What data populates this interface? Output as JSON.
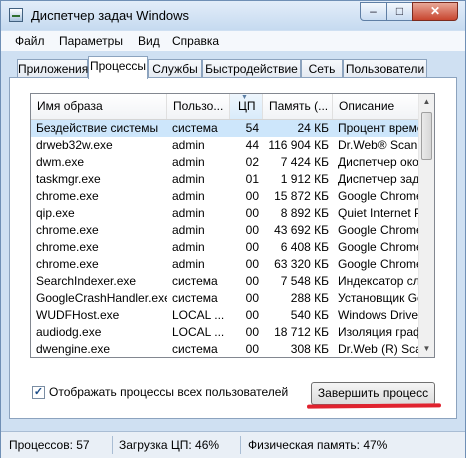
{
  "window": {
    "title": "Диспетчер задач Windows",
    "close_glyph": "✕",
    "min_glyph": "–",
    "max_glyph": "□"
  },
  "menu": [
    "Файл",
    "Параметры",
    "Вид",
    "Справка"
  ],
  "tabs": [
    "Приложения",
    "Процессы",
    "Службы",
    "Быстродействие",
    "Сеть",
    "Пользователи"
  ],
  "active_tab": "Процессы",
  "columns": [
    "Имя образа",
    "Пользо...",
    "ЦП",
    "Память (...",
    "Описание"
  ],
  "processes": [
    {
      "name": "Бездействие системы",
      "user": "система",
      "cpu": "54",
      "mem": "24 КБ",
      "desc": "Процент времен"
    },
    {
      "name": "drweb32w.exe",
      "user": "admin",
      "cpu": "44",
      "mem": "116 904 КБ",
      "desc": "Dr.Web® Scann"
    },
    {
      "name": "dwm.exe",
      "user": "admin",
      "cpu": "02",
      "mem": "7 424 КБ",
      "desc": "Диспетчер окон"
    },
    {
      "name": "taskmgr.exe",
      "user": "admin",
      "cpu": "01",
      "mem": "1 912 КБ",
      "desc": "Диспетчер зада"
    },
    {
      "name": "chrome.exe",
      "user": "admin",
      "cpu": "00",
      "mem": "15 872 КБ",
      "desc": "Google Chrome"
    },
    {
      "name": "qip.exe",
      "user": "admin",
      "cpu": "00",
      "mem": "8 892 КБ",
      "desc": "Quiet Internet P"
    },
    {
      "name": "chrome.exe",
      "user": "admin",
      "cpu": "00",
      "mem": "43 692 КБ",
      "desc": "Google Chrome"
    },
    {
      "name": "chrome.exe",
      "user": "admin",
      "cpu": "00",
      "mem": "6 408 КБ",
      "desc": "Google Chrome"
    },
    {
      "name": "chrome.exe",
      "user": "admin",
      "cpu": "00",
      "mem": "63 320 КБ",
      "desc": "Google Chrome"
    },
    {
      "name": "SearchIndexer.exe",
      "user": "система",
      "cpu": "00",
      "mem": "7 548 КБ",
      "desc": "Индексатор слу"
    },
    {
      "name": "GoogleCrashHandler.exe",
      "user": "система",
      "cpu": "00",
      "mem": "288 КБ",
      "desc": "Установщик Goo"
    },
    {
      "name": "WUDFHost.exe",
      "user": "LOCAL ...",
      "cpu": "00",
      "mem": "540 КБ",
      "desc": "Windows Driver"
    },
    {
      "name": "audiodg.exe",
      "user": "LOCAL ...",
      "cpu": "00",
      "mem": "18 712 КБ",
      "desc": "Изоляция графо"
    },
    {
      "name": "dwengine.exe",
      "user": "система",
      "cpu": "00",
      "mem": "308 КБ",
      "desc": "Dr.Web (R) Scar"
    }
  ],
  "show_all_users_label": "Отображать процессы всех пользователей",
  "show_all_users_checked": true,
  "end_process_label": "Завершить процесс",
  "status": {
    "processes": "Процессов: 57",
    "cpu": "Загрузка ЦП: 46%",
    "memory": "Физическая память: 47%"
  },
  "colors": {
    "selection": "#cde6fb",
    "annotation_underline": "#e0222e"
  }
}
